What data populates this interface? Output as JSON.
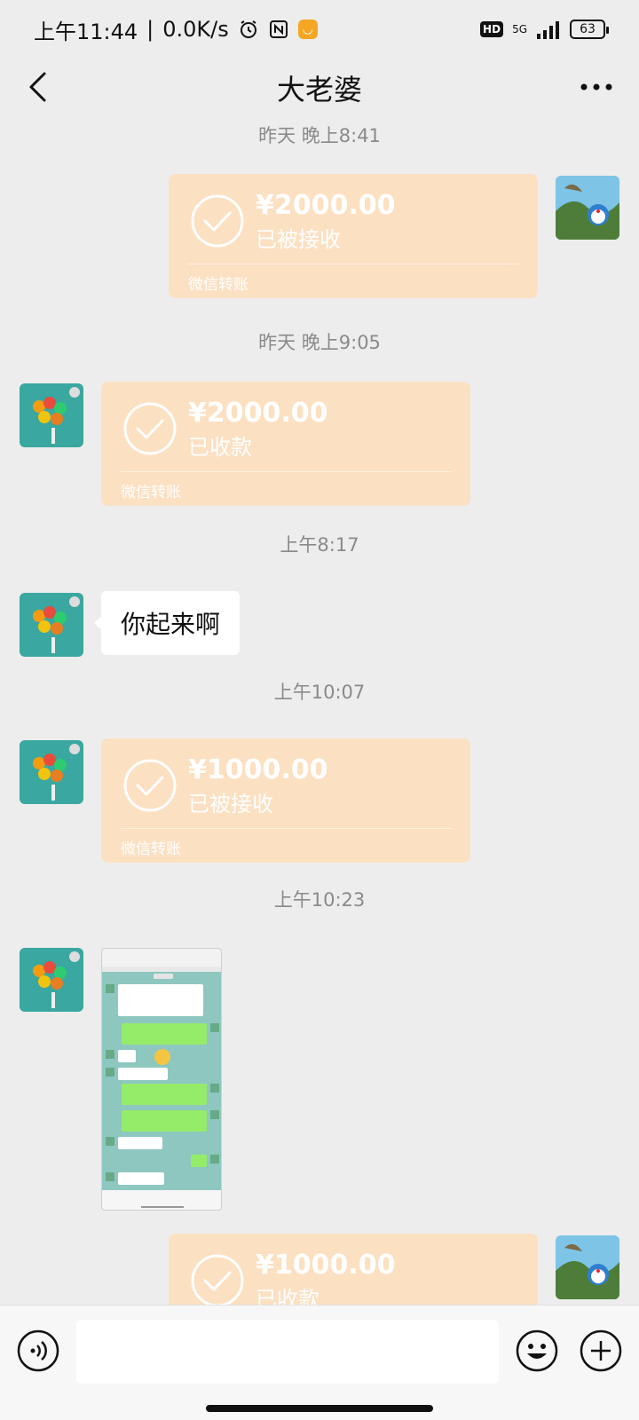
{
  "status_bar": {
    "time": "上午11:44",
    "separator": "|",
    "net_speed": "0.0K/s",
    "hd": "HD",
    "network": "5G",
    "battery": "63"
  },
  "nav": {
    "title": "大老婆"
  },
  "messages": {
    "t1": "昨天 晚上8:41",
    "m1": {
      "amount": "¥2000.00",
      "status": "已被接收",
      "footer": "微信转账"
    },
    "t2": "昨天 晚上9:05",
    "m2": {
      "amount": "¥2000.00",
      "status": "已收款",
      "footer": "微信转账"
    },
    "t3": "上午8:17",
    "m3": {
      "text": "你起来啊"
    },
    "t4": "上午10:07",
    "m4": {
      "amount": "¥1000.00",
      "status": "已被接收",
      "footer": "微信转账"
    },
    "t5": "上午10:23",
    "m6": {
      "amount": "¥1000.00",
      "status": "已收款"
    }
  },
  "input": {
    "value": "",
    "placeholder": ""
  },
  "colors": {
    "transfer_bubble": "#fce0c2",
    "chat_bg": "#ededed",
    "screenshot_bg": "#8ec7bf"
  }
}
